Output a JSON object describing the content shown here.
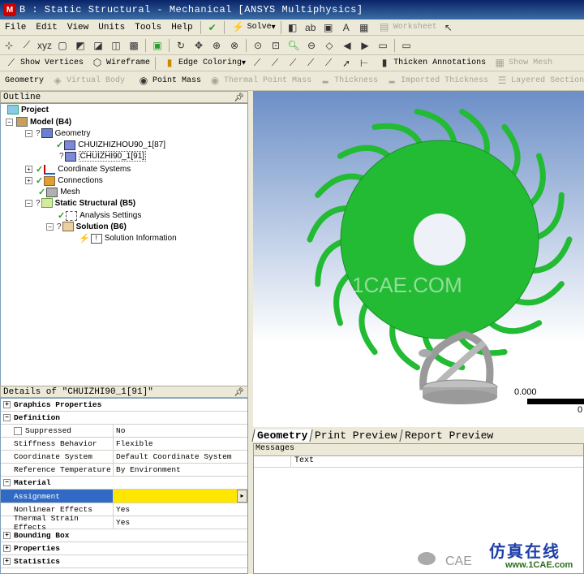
{
  "window": {
    "title": "B : Static Structural - Mechanical [ANSYS Multiphysics]",
    "logo_letter": "M"
  },
  "menu": [
    "File",
    "Edit",
    "View",
    "Units",
    "Tools",
    "Help"
  ],
  "toolbar1": {
    "solve_label": "Solve",
    "worksheet_label": "Worksheet"
  },
  "toolbar3": {
    "show_vertices": "Show Vertices",
    "wireframe": "Wireframe",
    "edge_coloring": "Edge Coloring",
    "thicken_annotations": "Thicken Annotations",
    "show_mesh": "Show Mesh"
  },
  "toolbar4": {
    "geometry": "Geometry",
    "virtual_body": "Virtual Body",
    "point_mass": "Point Mass",
    "thermal_point_mass": "Thermal Point Mass",
    "thickness": "Thickness",
    "imported_thickness": "Imported Thickness",
    "layered_section": "Layered Section"
  },
  "outline": {
    "header": "Outline",
    "nodes": {
      "project": "Project",
      "model": "Model (B4)",
      "geometry": "Geometry",
      "body1": "CHUIZHIZHOU90_1[87]",
      "body2": "CHUIZHI90_1[91]",
      "coordinate_systems": "Coordinate Systems",
      "connections": "Connections",
      "mesh": "Mesh",
      "static_structural": "Static Structural (B5)",
      "analysis_settings": "Analysis Settings",
      "solution": "Solution (B6)",
      "solution_information": "Solution Information"
    }
  },
  "details": {
    "header": "Details of \"CHUIZHI90_1[91]\"",
    "groups": {
      "graphics_properties": "Graphics Properties",
      "definition": "Definition",
      "material": "Material",
      "bounding_box": "Bounding Box",
      "properties": "Properties",
      "statistics": "Statistics"
    },
    "rows": {
      "suppressed": {
        "key": "Suppressed",
        "value": "No"
      },
      "stiffness": {
        "key": "Stiffness Behavior",
        "value": "Flexible"
      },
      "coord": {
        "key": "Coordinate System",
        "value": "Default Coordinate System"
      },
      "reftemp": {
        "key": "Reference Temperature",
        "value": "By Environment"
      },
      "assignment": {
        "key": "Assignment",
        "value": ""
      },
      "nonlinear": {
        "key": "Nonlinear Effects",
        "value": "Yes"
      },
      "thermal": {
        "key": "Thermal Strain Effects",
        "value": "Yes"
      }
    }
  },
  "viewport": {
    "scale_label": "0.000",
    "scale_label_right": "0",
    "watermark": "1CAE.COM",
    "body_color": "#22bb33"
  },
  "tabs": [
    "Geometry",
    "Print Preview",
    "Report Preview"
  ],
  "messages": {
    "header": "Messages",
    "column": "Text"
  },
  "watermarks": {
    "cn": "仿真在线",
    "url": "www.1CAE.com",
    "cae": "CAE"
  },
  "colors": {
    "title_bar": "#0a246a",
    "selection": "#316ac5",
    "assignment_highlight": "#ffe600"
  }
}
